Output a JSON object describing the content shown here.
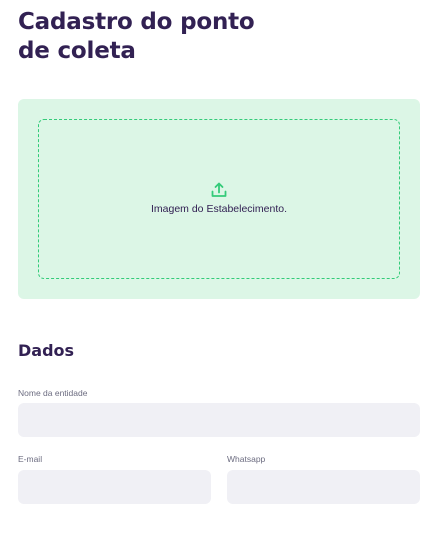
{
  "page": {
    "title": "Cadastro do ponto de coleta"
  },
  "dropzone": {
    "icon": "upload-icon",
    "text": "Imagem do Estabelecimento.",
    "background_color": "#dcf6e6",
    "border_color": "#34cb79"
  },
  "form": {
    "section_title": "Dados",
    "fields": {
      "entity_name": {
        "label": "Nome da entidade",
        "value": ""
      },
      "email": {
        "label": "E-mail",
        "value": ""
      },
      "whatsapp": {
        "label": "Whatsapp",
        "value": ""
      }
    }
  },
  "colors": {
    "title": "#322153",
    "label": "#6c6c80",
    "input_background": "#f0f0f5",
    "accent": "#34cb79"
  }
}
